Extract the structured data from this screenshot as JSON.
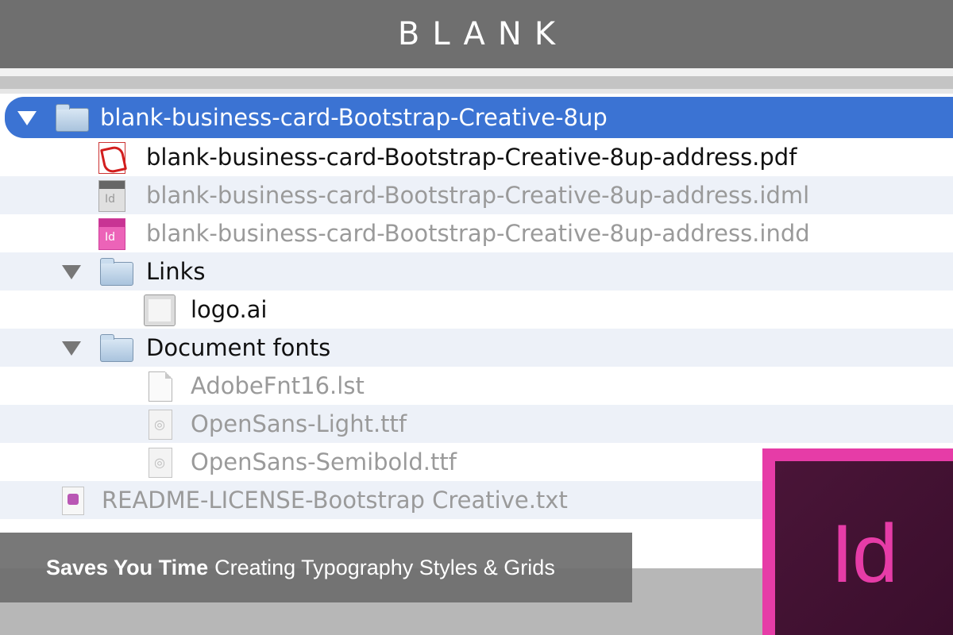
{
  "header": {
    "brand": "BLANK"
  },
  "tree": [
    {
      "label": "blank-business-card-Bootstrap-Creative-8up",
      "icon": "folder-icon",
      "selected": true
    },
    {
      "label": "blank-business-card-Bootstrap-Creative-8up-address.pdf",
      "icon": "pdf-file-icon"
    },
    {
      "label": "blank-business-card-Bootstrap-Creative-8up-address.idml",
      "icon": "idml-file-icon"
    },
    {
      "label": "blank-business-card-Bootstrap-Creative-8up-address.indd",
      "icon": "indd-file-icon"
    },
    {
      "label": "Links",
      "icon": "folder-icon"
    },
    {
      "label": "logo.ai",
      "icon": "ai-file-icon"
    },
    {
      "label": "Document fonts",
      "icon": "folder-icon"
    },
    {
      "label": "AdobeFnt16.lst",
      "icon": "document-icon"
    },
    {
      "label": "OpenSans-Light.ttf",
      "icon": "font-file-icon"
    },
    {
      "label": "OpenSans-Semibold.ttf",
      "icon": "font-file-icon"
    },
    {
      "label": "README-LICENSE-Bootstrap Creative.txt",
      "icon": "text-file-icon"
    }
  ],
  "caption": {
    "bold": "Saves You Time",
    "rest": "Creating Typography Styles & Grids"
  },
  "app_logo": {
    "text": "Id",
    "name": "indesign-logo"
  },
  "colors": {
    "selection": "#3b73d3",
    "accent": "#e63ca7",
    "header_bg": "#6f6f6f"
  }
}
